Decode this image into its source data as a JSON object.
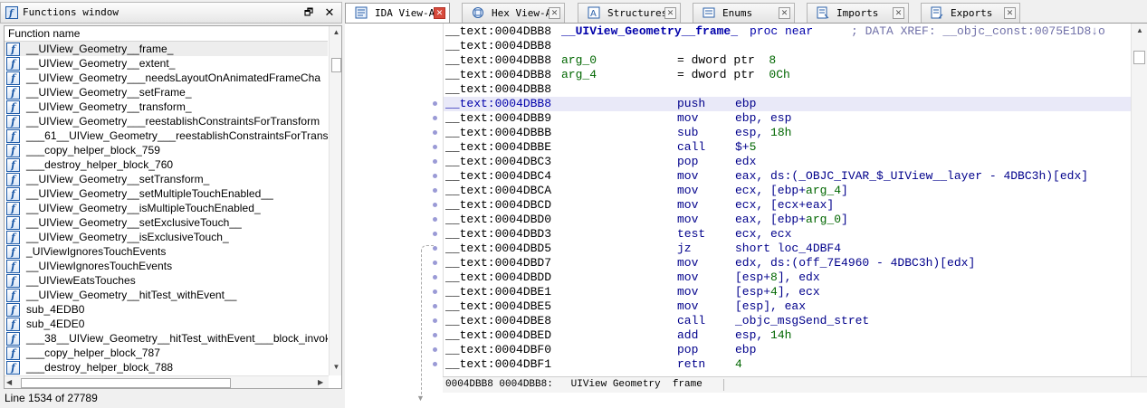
{
  "functions_window": {
    "title": "Functions window",
    "float_glyph": "🗗",
    "close_glyph": "✕",
    "column_header": "Function name",
    "functions": [
      "__UIView_Geometry__frame_",
      "__UIView_Geometry__extent_",
      "__UIView_Geometry___needsLayoutOnAnimatedFrameCha",
      "__UIView_Geometry__setFrame_",
      "__UIView_Geometry__transform_",
      "__UIView_Geometry___reestablishConstraintsForTransform",
      "___61__UIView_Geometry___reestablishConstraintsForTrans",
      "___copy_helper_block_759",
      "___destroy_helper_block_760",
      "__UIView_Geometry__setTransform_",
      "__UIView_Geometry__setMultipleTouchEnabled__",
      "__UIView_Geometry__isMultipleTouchEnabled_",
      "__UIView_Geometry__setExclusiveTouch__",
      "__UIView_Geometry__isExclusiveTouch_",
      "_UIViewIgnoresTouchEvents",
      "__UIViewIgnoresTouchEvents",
      "__UIViewEatsTouches",
      "__UIView_Geometry__hitTest_withEvent__",
      "sub_4EDB0",
      "sub_4EDE0",
      "___38__UIView_Geometry__hitTest_withEvent___block_invok",
      "___copy_helper_block_787",
      "___destroy_helper_block_788"
    ],
    "status": "Line 1534 of 27789"
  },
  "tabs": [
    {
      "label": "IDA View-A",
      "active": true,
      "icon": "disassembly-icon"
    },
    {
      "label": "Hex View-A",
      "active": false,
      "icon": "hex-icon"
    },
    {
      "label": "Structures",
      "active": false,
      "icon": "structures-icon"
    },
    {
      "label": "Enums",
      "active": false,
      "icon": "enums-icon"
    },
    {
      "label": "Imports",
      "active": false,
      "icon": "imports-icon"
    },
    {
      "label": "Exports",
      "active": false,
      "icon": "exports-icon"
    }
  ],
  "disassembly": {
    "lines": [
      {
        "seg": "__text:0004DBB8",
        "label": "__UIView_Geometry__frame_",
        "label_kind": "name",
        "proc": "proc near",
        "comment": "; DATA XREF: __objc_const:0075E1D8↓o"
      },
      {
        "seg": "__text:0004DBB8"
      },
      {
        "seg": "__text:0004DBB8",
        "label": "arg_0",
        "label_kind": "arg",
        "eq": "= dword ptr  ",
        "eqnum": "8"
      },
      {
        "seg": "__text:0004DBB8",
        "label": "arg_4",
        "label_kind": "arg",
        "eq": "= dword ptr  ",
        "eqnum": "0Ch"
      },
      {
        "seg": "__text:0004DBB8"
      },
      {
        "seg": "__text:0004DBB8",
        "mn": "push",
        "op": "ebp",
        "current": true
      },
      {
        "seg": "__text:0004DBB9",
        "mn": "mov",
        "op": "ebp, esp"
      },
      {
        "seg": "__text:0004DBBB",
        "mn": "sub",
        "op": "esp, ",
        "opnum": "18h"
      },
      {
        "seg": "__text:0004DBBE",
        "mn": "call",
        "op": "$+",
        "opnum": "5"
      },
      {
        "seg": "__text:0004DBC3",
        "mn": "pop",
        "op": "edx"
      },
      {
        "seg": "__text:0004DBC4",
        "mn": "mov",
        "op": "eax, ds:(_OBJC_IVAR_$_UIView__layer - 4DBC3h)[edx]"
      },
      {
        "seg": "__text:0004DBCA",
        "mn": "mov",
        "op": "ecx, [ebp+",
        "oparg": "arg_4",
        "optail": "]"
      },
      {
        "seg": "__text:0004DBCD",
        "mn": "mov",
        "op": "ecx, [ecx+eax]"
      },
      {
        "seg": "__text:0004DBD0",
        "mn": "mov",
        "op": "eax, [ebp+",
        "oparg": "arg_0",
        "optail": "]"
      },
      {
        "seg": "__text:0004DBD3",
        "mn": "test",
        "op": "ecx, ecx"
      },
      {
        "seg": "__text:0004DBD5",
        "mn": "jz",
        "op": "short loc_4DBF4"
      },
      {
        "seg": "__text:0004DBD7",
        "mn": "mov",
        "op": "edx, ds:(off_7E4960 - 4DBC3h)[edx]"
      },
      {
        "seg": "__text:0004DBDD",
        "mn": "mov",
        "op": "[esp+",
        "opnum": "8",
        "optail": "], edx"
      },
      {
        "seg": "__text:0004DBE1",
        "mn": "mov",
        "op": "[esp+",
        "opnum": "4",
        "optail": "], ecx"
      },
      {
        "seg": "__text:0004DBE5",
        "mn": "mov",
        "op": "[esp], eax"
      },
      {
        "seg": "__text:0004DBE8",
        "mn": "call",
        "op": "_objc_msgSend_stret"
      },
      {
        "seg": "__text:0004DBED",
        "mn": "add",
        "op": "esp, ",
        "opnum": "14h"
      },
      {
        "seg": "__text:0004DBF0",
        "mn": "pop",
        "op": "ebp"
      },
      {
        "seg": "__text:0004DBF1",
        "mn": "retn",
        "op": "",
        "opnum": "4"
      }
    ],
    "status_bar": "0004DBB8 0004DBB8:   UIView Geometry  frame"
  },
  "colors": {
    "code_blue": "#00008b",
    "name_blue": "#0000aa",
    "number_green": "#006600",
    "comment": "#7070a8",
    "active_close": "#d84b3c"
  }
}
